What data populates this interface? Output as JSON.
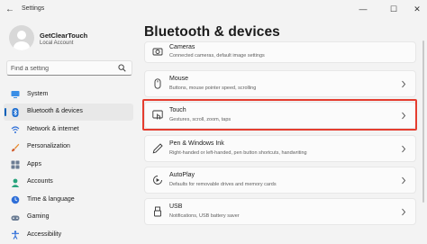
{
  "window": {
    "title": "Settings",
    "back_glyph": "←",
    "minimize_glyph": "—",
    "maximize_glyph": "☐",
    "close_glyph": "✕"
  },
  "user": {
    "name": "GetClearTouch",
    "account_type": "Local Account"
  },
  "search": {
    "placeholder": "Find a setting",
    "icon": "search-icon"
  },
  "nav": {
    "items": [
      {
        "label": "System",
        "icon": "monitor-icon",
        "active": false
      },
      {
        "label": "Bluetooth & devices",
        "icon": "bluetooth-icon",
        "active": true
      },
      {
        "label": "Network & internet",
        "icon": "wifi-icon",
        "active": false
      },
      {
        "label": "Personalization",
        "icon": "paintbrush-icon",
        "active": false
      },
      {
        "label": "Apps",
        "icon": "apps-icon",
        "active": false
      },
      {
        "label": "Accounts",
        "icon": "person-icon",
        "active": false
      },
      {
        "label": "Time & language",
        "icon": "globe-clock-icon",
        "active": false
      },
      {
        "label": "Gaming",
        "icon": "gamepad-icon",
        "active": false
      },
      {
        "label": "Accessibility",
        "icon": "accessibility-icon",
        "active": false
      }
    ]
  },
  "page": {
    "title": "Bluetooth & devices"
  },
  "cards": [
    {
      "title": "Cameras",
      "desc": "Connected cameras, default image settings",
      "icon": "camera-icon"
    },
    {
      "title": "Mouse",
      "desc": "Buttons, mouse pointer speed, scrolling",
      "icon": "mouse-icon"
    },
    {
      "title": "Touch",
      "desc": "Gestures, scroll, zoom, taps",
      "icon": "touch-icon",
      "highlighted": true
    },
    {
      "title": "Pen & Windows Ink",
      "desc": "Right-handed or left-handed, pen button shortcuts, handwriting",
      "icon": "pen-icon"
    },
    {
      "title": "AutoPlay",
      "desc": "Defaults for removable drives and memory cards",
      "icon": "autoplay-icon"
    },
    {
      "title": "USB",
      "desc": "Notifications, USB battery saver",
      "icon": "usb-icon"
    }
  ],
  "colors": {
    "accent": "#005fb8",
    "highlight_border": "#e53d2f",
    "background": "#f3f3f3",
    "card_background": "#fbfbfb"
  }
}
